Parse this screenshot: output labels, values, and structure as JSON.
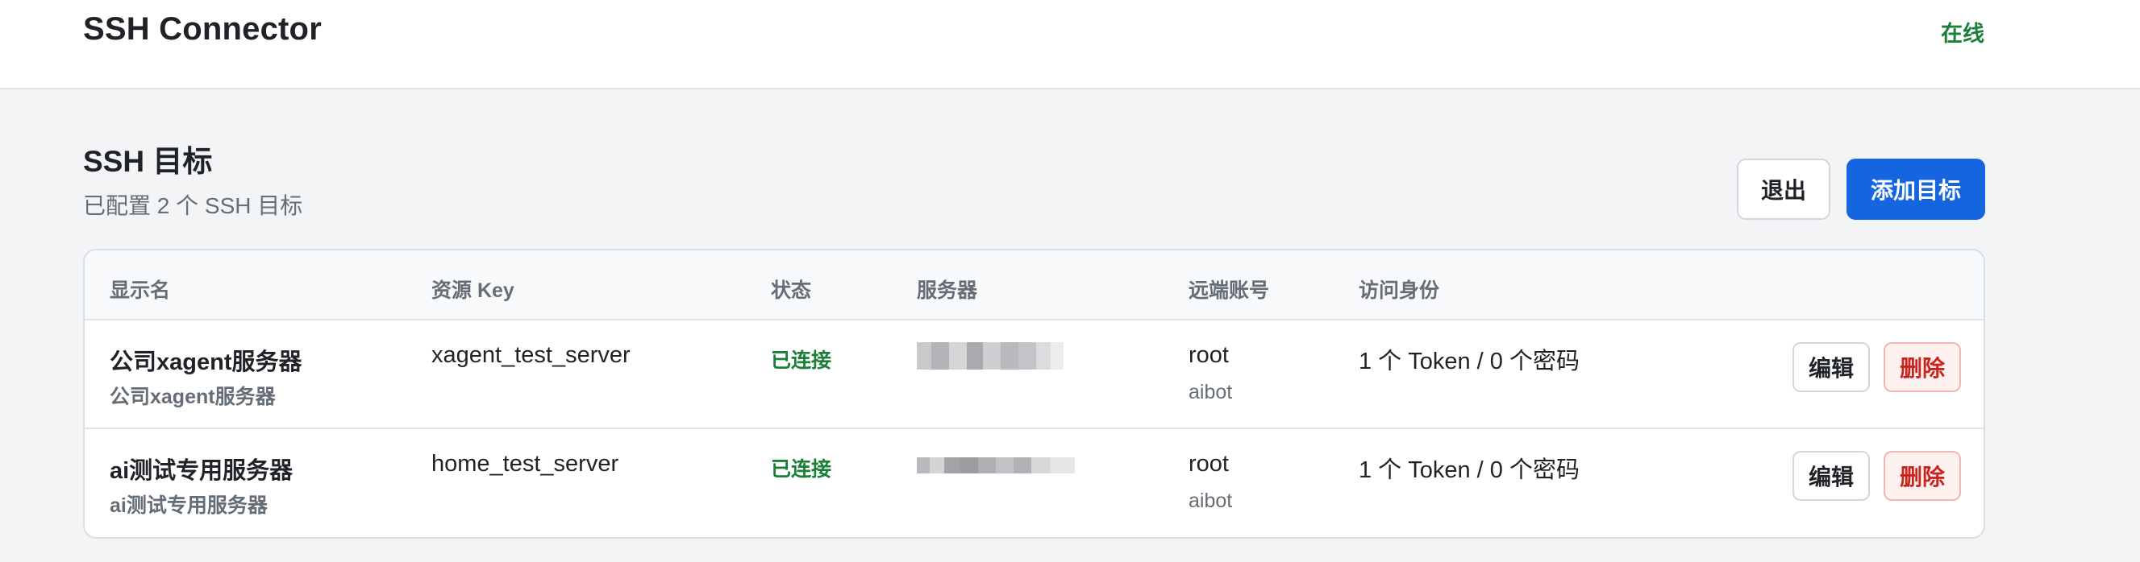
{
  "header": {
    "title": "SSH Connector",
    "status": "在线"
  },
  "section": {
    "title": "SSH 目标",
    "subtitle": "已配置 2 个 SSH 目标",
    "logout_label": "退出",
    "add_label": "添加目标"
  },
  "table": {
    "headers": [
      "显示名",
      "资源 Key",
      "状态",
      "服务器",
      "远端账号",
      "访问身份"
    ],
    "rows": [
      {
        "name": "公司xagent服务器",
        "name_sub": "公司xagent服务器",
        "key": "xagent_test_server",
        "status": "已连接",
        "user": "root",
        "user_sub": "aibot",
        "access": "1 个 Token / 0 个密码",
        "edit_label": "编辑",
        "delete_label": "删除"
      },
      {
        "name": "ai测试专用服务器",
        "name_sub": "ai测试专用服务器",
        "key": "home_test_server",
        "status": "已连接",
        "user": "root",
        "user_sub": "aibot",
        "access": "1 个 Token / 0 个密码",
        "edit_label": "编辑",
        "delete_label": "删除"
      }
    ]
  },
  "colors": {
    "accent": "#1565e0",
    "success": "#1a7f37",
    "danger": "#c9231c"
  }
}
